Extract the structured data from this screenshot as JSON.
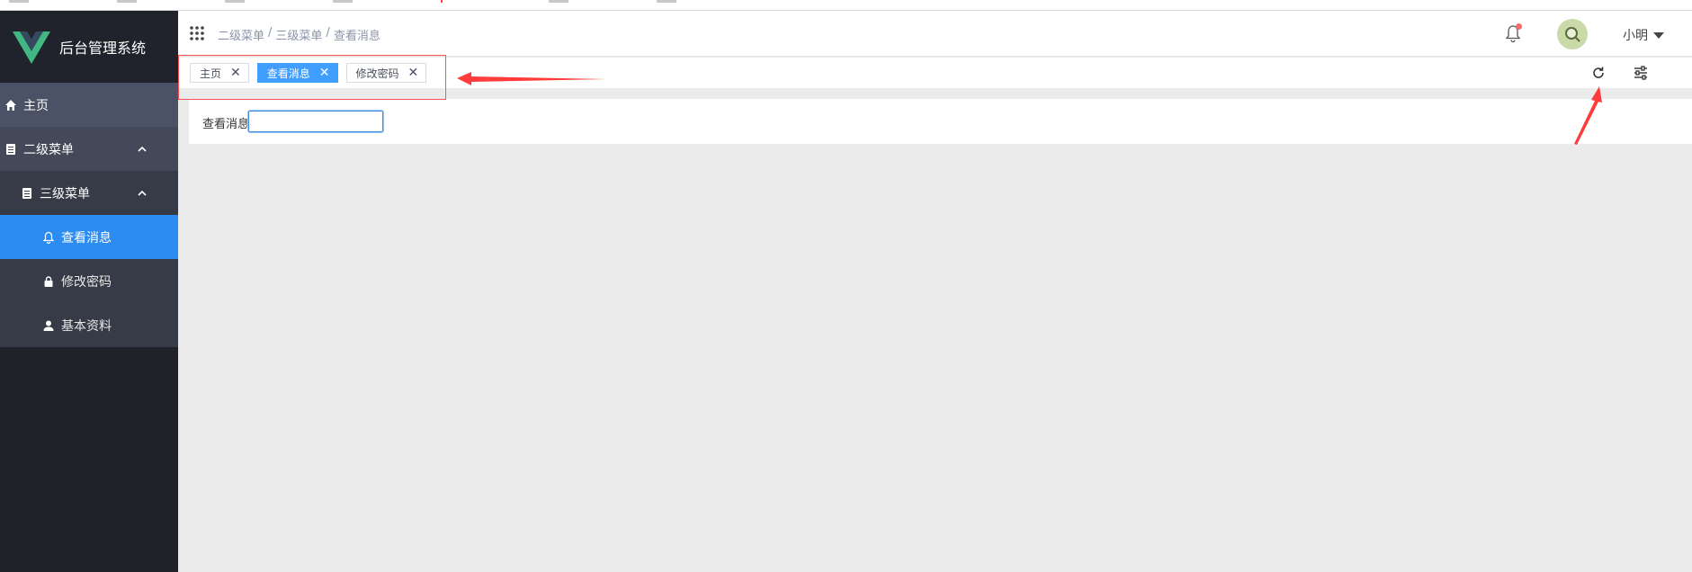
{
  "app": {
    "title": "后台管理系统"
  },
  "sidebar": {
    "items": [
      {
        "label": "主页"
      },
      {
        "label": "二级菜单"
      },
      {
        "label": "三级菜单"
      },
      {
        "label": "查看消息"
      },
      {
        "label": "修改密码"
      },
      {
        "label": "基本资料"
      }
    ]
  },
  "header": {
    "breadcrumb": [
      "二级菜单",
      "三级菜单",
      "查看消息"
    ],
    "separator": "/",
    "username": "小明"
  },
  "tags": [
    {
      "label": "主页",
      "active": false
    },
    {
      "label": "查看消息",
      "active": true
    },
    {
      "label": "修改密码",
      "active": false
    }
  ],
  "content": {
    "field_label": "查看消息",
    "field_value": ""
  },
  "colors": {
    "accent": "#2d8cf0",
    "tag_active": "#409eff",
    "sidebar_bg": "#1f2229",
    "annotation": "#ff3b3b"
  }
}
